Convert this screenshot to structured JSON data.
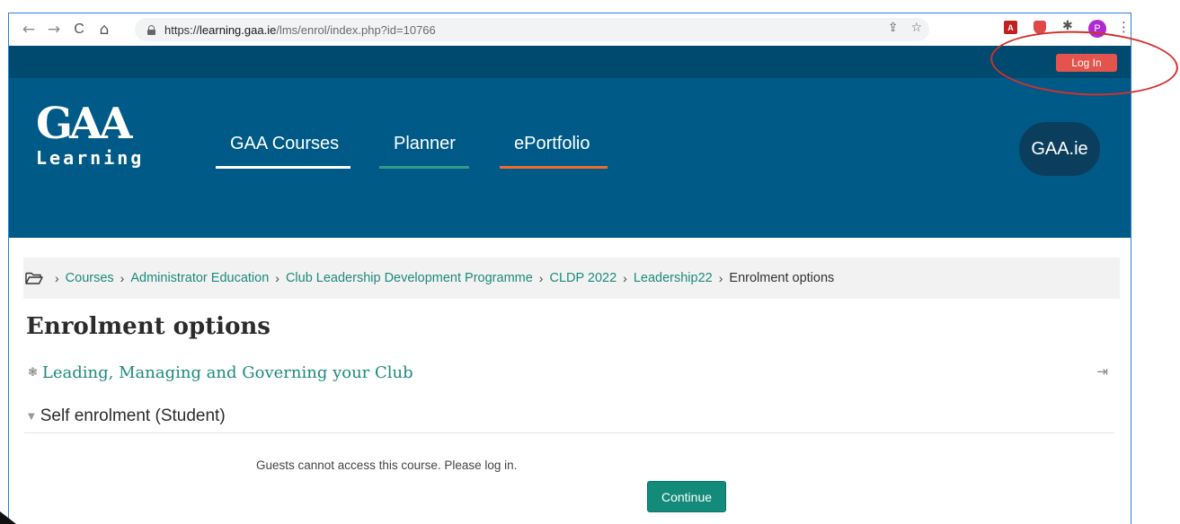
{
  "browser": {
    "back_glyph": "←",
    "forward_glyph": "→",
    "reload_glyph": "C",
    "home_glyph": "⌂",
    "url_prefix": "https://",
    "url_host": "learning.gaa.ie",
    "url_path": "/lms/enrol/index.php?id=10766",
    "share_glyph": "⇪",
    "star_glyph": "☆",
    "pdf_ext_label": "A",
    "puzzle_glyph": "✱",
    "profile_initial": "P",
    "menu_glyph": "⋮"
  },
  "topbar": {
    "login_label": "Log In"
  },
  "header": {
    "logo_mark": "GAA",
    "logo_word": "Learning",
    "nav": [
      {
        "label": "GAA Courses",
        "underline_color": "#ffffff"
      },
      {
        "label": "Planner",
        "underline_color": "#2f9a8c"
      },
      {
        "label": "ePortfolio",
        "underline_color": "#f06b2a"
      }
    ],
    "site_link": "GAA.ie"
  },
  "breadcrumb": {
    "items": [
      "Courses",
      "Administrator Education",
      "Club Leadership Development Programme",
      "CLDP 2022",
      "Leadership22"
    ],
    "current": "Enrolment options"
  },
  "page": {
    "title": "Enrolment options",
    "course_name": "Leading, Managing and Governing your Club",
    "section_title": "Self enrolment (Student)",
    "guest_message": "Guests cannot access this course. Please log in.",
    "continue_label": "Continue"
  },
  "colors": {
    "topbar_bg": "#004a70",
    "header_bg": "#005a87",
    "login_btn": "#e4534c",
    "link": "#1d8a7d",
    "continue_btn": "#138a7a",
    "annotation": "#d0312d"
  }
}
